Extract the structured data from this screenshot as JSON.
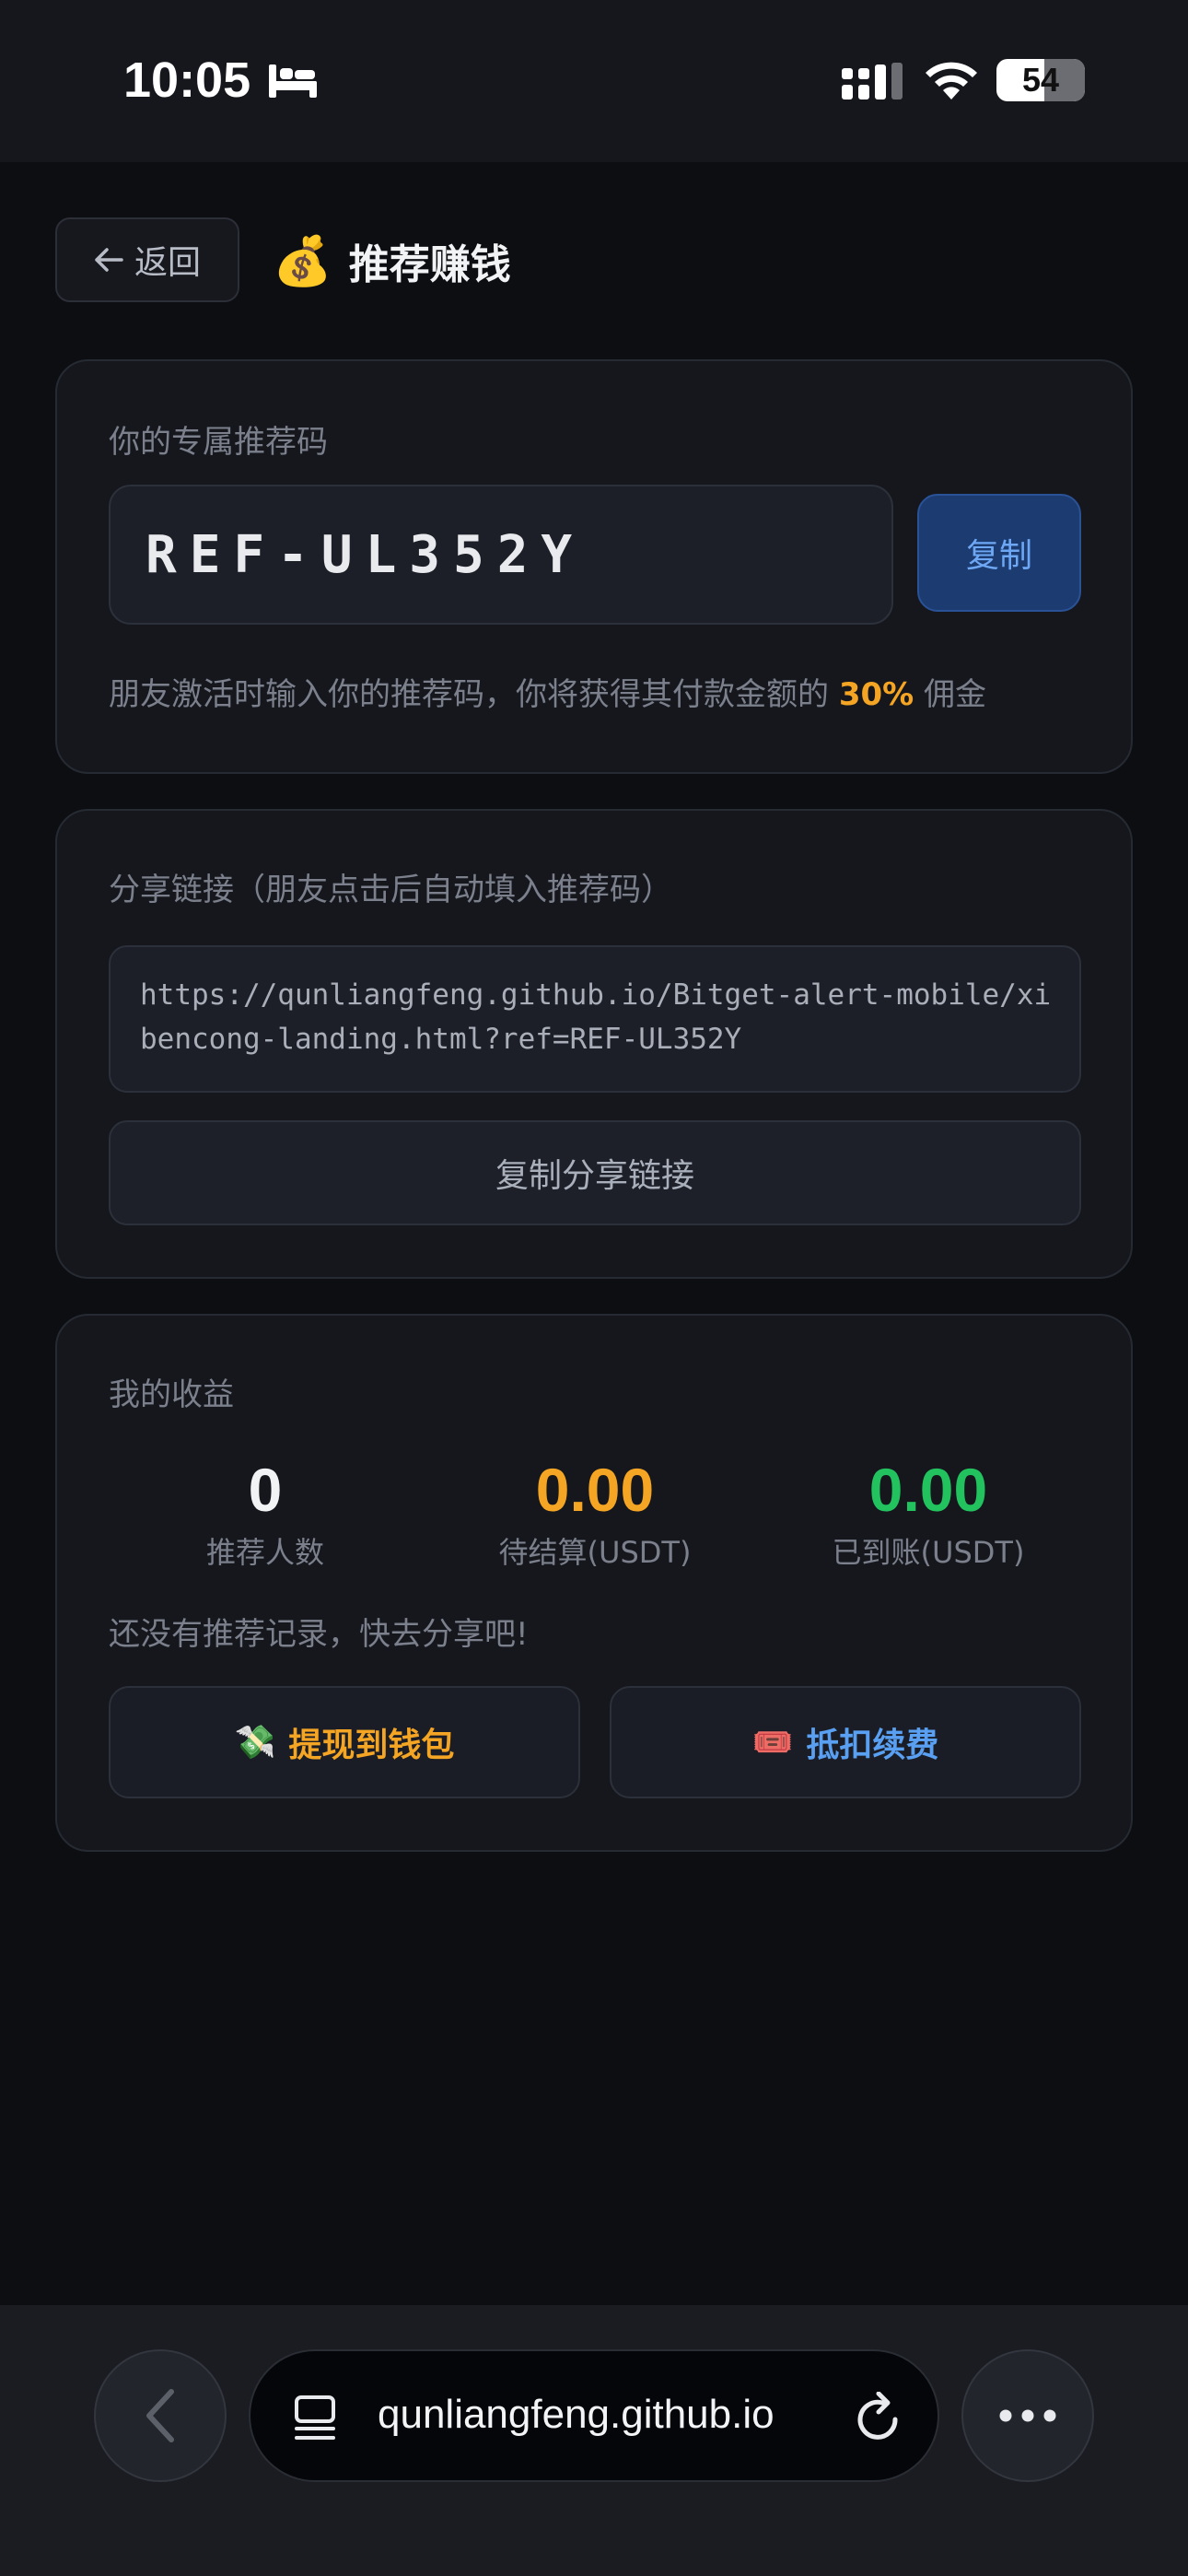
{
  "status_bar": {
    "time": "10:05",
    "battery": "54"
  },
  "header": {
    "back_label": "返回",
    "title": "推荐赚钱"
  },
  "referral_code_card": {
    "label": "你的专属推荐码",
    "code": "REF-UL352Y",
    "copy_label": "复制",
    "hint_before": "朋友激活时输入你的推荐码，你将获得其付款金额的",
    "hint_percent": "30%",
    "hint_after": "佣金"
  },
  "share_card": {
    "label": "分享链接（朋友点击后自动填入推荐码）",
    "link": "https://qunliangfeng.github.io/Bitget-alert-mobile/xibencong-landing.html?ref=REF-UL352Y",
    "copy_link_label": "复制分享链接"
  },
  "earnings_card": {
    "label": "我的收益",
    "stats": [
      {
        "value": "0",
        "label": "推荐人数",
        "color": "#f1f3f5"
      },
      {
        "value": "0.00",
        "label": "待结算(USDT)",
        "color": "#f5a524"
      },
      {
        "value": "0.00",
        "label": "已到账(USDT)",
        "color": "#22c35e"
      }
    ],
    "empty_note": "还没有推荐记录，快去分享吧!",
    "withdraw_label": "提现到钱包",
    "deduct_label": "抵扣续费",
    "withdraw_color": "#f5a524",
    "deduct_color": "#5aa0f2"
  },
  "browser": {
    "url": "qunliangfeng.github.io"
  }
}
